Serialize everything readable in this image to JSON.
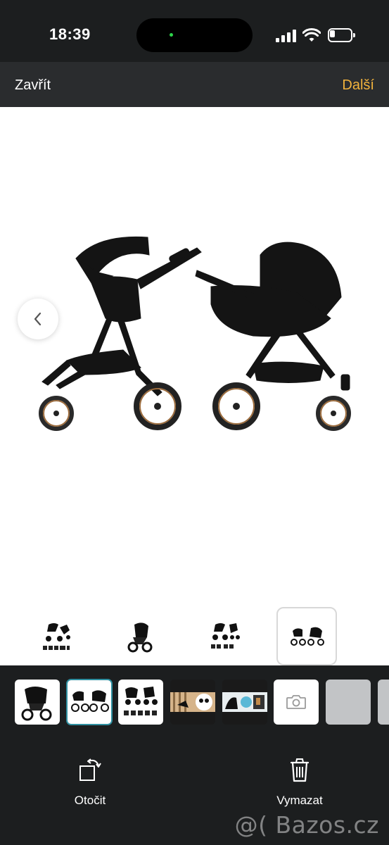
{
  "status_bar": {
    "time": "18:39",
    "battery_level": 0.25
  },
  "nav": {
    "close_label": "Zavřít",
    "next_label": "Další",
    "accent_color": "#f2b33d"
  },
  "viewer": {
    "selected_thumbnail": 4,
    "thumbnails_count": 4
  },
  "filmstrip": {
    "items": [
      "photo-1",
      "photo-2",
      "photo-3",
      "photo-4",
      "photo-5",
      "add-photo",
      "placeholder",
      "placeholder"
    ],
    "selected_index": 1,
    "selected_color": "#2f8fa0"
  },
  "toolbar": {
    "rotate_label": "Otočit",
    "delete_label": "Vymazat"
  },
  "watermark": "@( Bazos.cz",
  "icons": [
    "chevron-left-icon",
    "rotate-icon",
    "trash-icon",
    "camera-icon",
    "wifi-icon",
    "signal-icon",
    "battery-icon"
  ]
}
